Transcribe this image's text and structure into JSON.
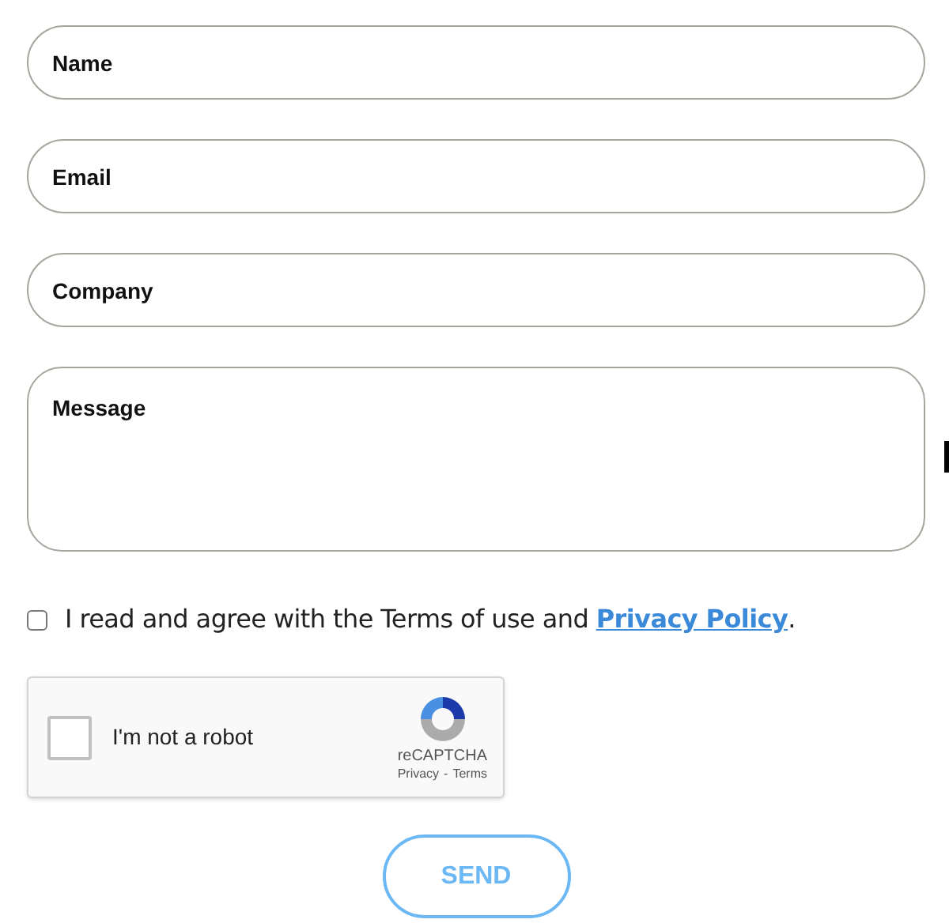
{
  "fields": [
    {
      "kind": "input",
      "placeholder": "Name"
    },
    {
      "kind": "input",
      "placeholder": "Email"
    },
    {
      "kind": "input",
      "placeholder": "Company"
    },
    {
      "kind": "textarea",
      "placeholder": "Message"
    }
  ],
  "consent": {
    "checked": false,
    "text": "I read and agree with the Terms of use and ",
    "link": "Privacy Policy",
    "after": "."
  },
  "recaptcha": {
    "checked": false,
    "label": "I'm not a robot",
    "brand": "reCAPTCHA",
    "privacy": "Privacy",
    "separator": "-",
    "terms": "Terms"
  },
  "send_button": "SEND"
}
